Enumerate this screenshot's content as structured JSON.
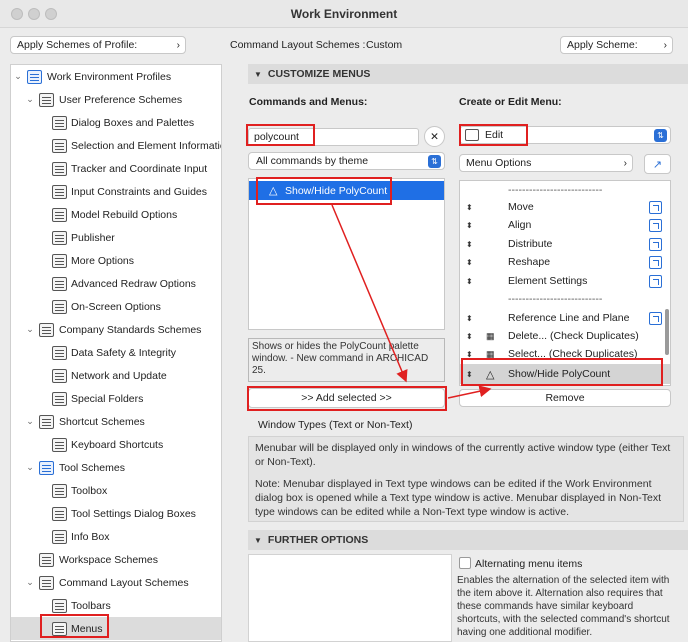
{
  "window": {
    "title": "Work Environment"
  },
  "toolbar": {
    "apply_profile_label": "Apply Schemes of Profile:",
    "command_layout_label": "Command Layout Schemes :",
    "command_layout_value": "Custom",
    "apply_scheme_label": "Apply Scheme:"
  },
  "tree": {
    "items": [
      {
        "label": "Work Environment Profiles"
      },
      {
        "label": "User Preference Schemes"
      },
      {
        "label": "Dialog Boxes and Palettes"
      },
      {
        "label": "Selection and Element Informatic"
      },
      {
        "label": "Tracker and Coordinate Input"
      },
      {
        "label": "Input Constraints and Guides"
      },
      {
        "label": "Model Rebuild Options"
      },
      {
        "label": "Publisher"
      },
      {
        "label": "More Options"
      },
      {
        "label": "Advanced Redraw Options"
      },
      {
        "label": "On-Screen Options"
      },
      {
        "label": "Company Standards Schemes"
      },
      {
        "label": "Data Safety & Integrity"
      },
      {
        "label": "Network and Update"
      },
      {
        "label": "Special Folders"
      },
      {
        "label": "Shortcut Schemes"
      },
      {
        "label": "Keyboard Shortcuts"
      },
      {
        "label": "Tool Schemes"
      },
      {
        "label": "Toolbox"
      },
      {
        "label": "Tool Settings Dialog Boxes"
      },
      {
        "label": "Info Box"
      },
      {
        "label": "Workspace Schemes"
      },
      {
        "label": "Command Layout Schemes"
      },
      {
        "label": "Toolbars"
      },
      {
        "label": "Menus"
      }
    ]
  },
  "customize": {
    "section_title": "CUSTOMIZE MENUS",
    "commands_label": "Commands and Menus:",
    "create_label": "Create or Edit Menu:",
    "search_value": "polycount",
    "clear_icon": "✕",
    "filter_value": "All commands by theme",
    "command_result": "Show/Hide PolyCount",
    "description": "Shows or hides the PolyCount palette window. - New command in ARCHICAD 25.",
    "add_button": ">> Add selected >>",
    "menu_select_value": "Edit",
    "menu_options_label": "Menu Options",
    "remove_button": "Remove",
    "menu_items": [
      {
        "label": "---------------------------",
        "icon": "none"
      },
      {
        "label": "Move",
        "icon": "none"
      },
      {
        "label": "Align",
        "icon": "none"
      },
      {
        "label": "Distribute",
        "icon": "none"
      },
      {
        "label": "Reshape",
        "icon": "none"
      },
      {
        "label": "Element Settings",
        "icon": "none"
      },
      {
        "label": "---------------------------",
        "icon": "none"
      },
      {
        "label": "Reference Line and Plane",
        "icon": "none"
      },
      {
        "label": "Delete... (Check Duplicates)",
        "icon": "dup"
      },
      {
        "label": "Select... (Check Duplicates)",
        "icon": "dup"
      },
      {
        "label": "Show/Hide PolyCount",
        "icon": "poly"
      }
    ]
  },
  "window_types": {
    "title": "Window Types (Text or Non-Text)",
    "para1": "Menubar will be displayed only in windows of the currently active window type (either Text or Non-Text).",
    "para2": "Note: Menubar displayed in Text type windows can be edited if the Work Environment dialog box is opened while a Text type window is active. Menubar displayed in Non-Text type windows can be edited while a Non-Text type window is active."
  },
  "further": {
    "section_title": "FURTHER OPTIONS",
    "alternating_label": "Alternating menu items",
    "alternating_desc": "Enables the alternation of the selected item with the item above it. Alternation also requires that these commands have similar keyboard shortcuts, with the selected command's shortcut having one additional modifier."
  },
  "colors": {
    "selection": "#1f6fe5",
    "annotation": "#e02020",
    "accent": "#2a6fd6"
  }
}
